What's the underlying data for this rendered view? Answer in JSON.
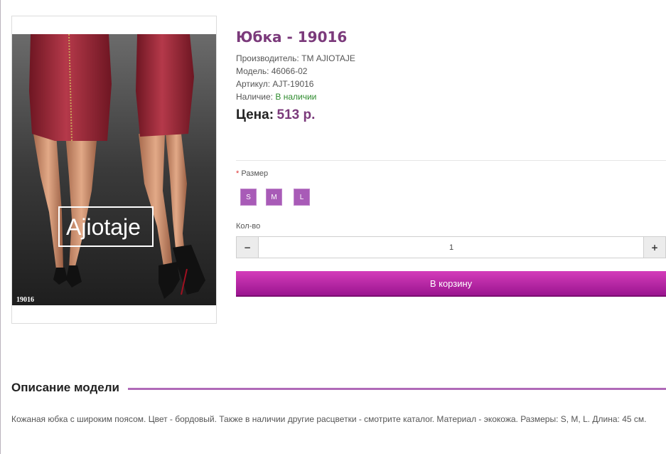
{
  "product": {
    "title": "Юбка - 19016",
    "manufacturer_label": "Производитель:",
    "manufacturer": "ТМ AJIOTAJE",
    "model_label": "Модель:",
    "model": "46066-02",
    "sku_label": "Артикул:",
    "sku": "AJT-19016",
    "availability_label": "Наличие:",
    "availability": "В наличии",
    "price_label": "Цена:",
    "price": "513 р."
  },
  "image": {
    "brand_text": "Ajiotaje",
    "code_text": "19016"
  },
  "options": {
    "size_label": "Размер",
    "required_mark": "*",
    "sizes": [
      "S",
      "M",
      "L"
    ],
    "quantity_label": "Кол-во",
    "quantity_value": "1",
    "minus_label": "−",
    "plus_label": "+"
  },
  "cart": {
    "button_label": "В корзину"
  },
  "description": {
    "title": "Описание модели",
    "text": "Кожаная юбка с широким поясом. Цвет - бордовый. Также в наличии другие расцветки - смотрите каталог. Материал - экокожа. Размеры: S, M, L. Длина: 45 см."
  },
  "colors": {
    "accent": "#7b3a7b",
    "size_button": "#a85bb7",
    "cart_button": "#c02aab",
    "in_stock": "#2e8b2e"
  }
}
